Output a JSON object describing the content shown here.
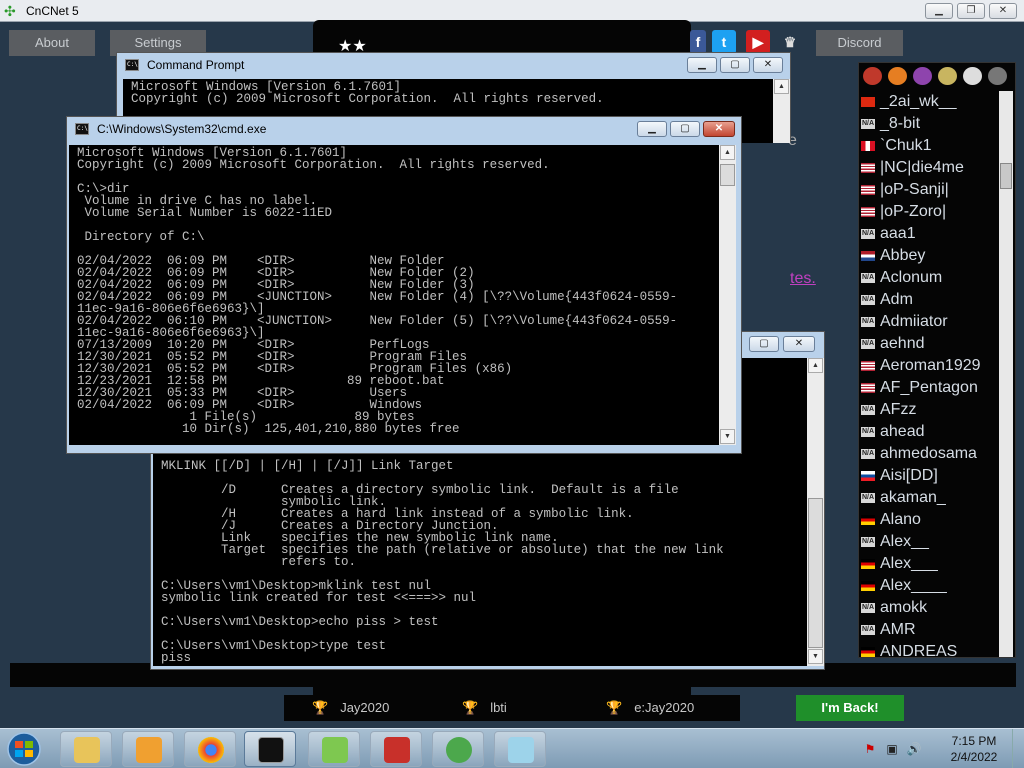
{
  "app": {
    "title": "CnCNet 5",
    "about_label": "About",
    "settings_label": "Settings",
    "discord_label": "Discord",
    "im_back_label": "I'm Back!",
    "link_fragment": "tes.",
    "e_fragment": "e"
  },
  "games": [
    {
      "name": "Jay2020"
    },
    {
      "name": "lbti"
    },
    {
      "name": "e:Jay2020"
    }
  ],
  "players": [
    {
      "name": "_2ai_wk__",
      "flag": "cn"
    },
    {
      "name": "_8-bit",
      "flag": "na"
    },
    {
      "name": "`Chuk1",
      "flag": "pe"
    },
    {
      "name": "|NC|die4me",
      "flag": "us"
    },
    {
      "name": "|oP-Sanji|",
      "flag": "us"
    },
    {
      "name": "|oP-Zoro|",
      "flag": "us"
    },
    {
      "name": "aaa1",
      "flag": "na"
    },
    {
      "name": "Abbey",
      "flag": "nl"
    },
    {
      "name": "Aclonum",
      "flag": "na"
    },
    {
      "name": "Adm",
      "flag": "na"
    },
    {
      "name": "Admiiator",
      "flag": "na"
    },
    {
      "name": "aehnd",
      "flag": "na"
    },
    {
      "name": "Aeroman1929",
      "flag": "us"
    },
    {
      "name": "AF_Pentagon",
      "flag": "us"
    },
    {
      "name": "AFzz",
      "flag": "na"
    },
    {
      "name": "ahead",
      "flag": "na"
    },
    {
      "name": "ahmedosama",
      "flag": "na"
    },
    {
      "name": "Aisi[DD]",
      "flag": "sk"
    },
    {
      "name": "akaman_",
      "flag": "na"
    },
    {
      "name": "Alano",
      "flag": "de"
    },
    {
      "name": "Alex__",
      "flag": "na"
    },
    {
      "name": "Alex___",
      "flag": "de"
    },
    {
      "name": "Alex____",
      "flag": "de"
    },
    {
      "name": "amokk",
      "flag": "na"
    },
    {
      "name": "AMR",
      "flag": "na"
    },
    {
      "name": "ANDREAS",
      "flag": "de"
    }
  ],
  "cmd_back": {
    "title": "Command Prompt",
    "text": "Microsoft Windows [Version 6.1.7601]\nCopyright (c) 2009 Microsoft Corporation.  All rights reserved."
  },
  "cmd_middle": {
    "text": "MKLINK [[/D] | [/H] | [/J]] Link Target\n\n        /D      Creates a directory symbolic link.  Default is a file\n                symbolic link.\n        /H      Creates a hard link instead of a symbolic link.\n        /J      Creates a Directory Junction.\n        Link    specifies the new symbolic link name.\n        Target  specifies the path (relative or absolute) that the new link\n                refers to.\n\nC:\\Users\\vm1\\Desktop>mklink test nul\nsymbolic link created for test <<===>> nul\n\nC:\\Users\\vm1\\Desktop>echo piss > test\n\nC:\\Users\\vm1\\Desktop>type test\npiss"
  },
  "cmd_front": {
    "title": "C:\\Windows\\System32\\cmd.exe",
    "text": "Microsoft Windows [Version 6.1.7601]\nCopyright (c) 2009 Microsoft Corporation.  All rights reserved.\n\nC:\\>dir\n Volume in drive C has no label.\n Volume Serial Number is 6022-11ED\n\n Directory of C:\\\n\n02/04/2022  06:09 PM    <DIR>          New Folder\n02/04/2022  06:09 PM    <DIR>          New Folder (2)\n02/04/2022  06:09 PM    <DIR>          New Folder (3)\n02/04/2022  06:09 PM    <JUNCTION>     New Folder (4) [\\??\\Volume{443f0624-0559-\n11ec-9a16-806e6f6e6963}\\]\n02/04/2022  06:10 PM    <JUNCTION>     New Folder (5) [\\??\\Volume{443f0624-0559-\n11ec-9a16-806e6f6e6963}\\]\n07/13/2009  10:20 PM    <DIR>          PerfLogs\n12/30/2021  05:52 PM    <DIR>          Program Files\n12/30/2021  05:52 PM    <DIR>          Program Files (x86)\n12/23/2021  12:58 PM                89 reboot.bat\n12/30/2021  05:33 PM    <DIR>          Users\n02/04/2022  06:09 PM    <DIR>          Windows\n               1 File(s)             89 bytes\n              10 Dir(s)  125,401,210,880 bytes free"
  },
  "clock": {
    "time": "7:15 PM",
    "date": "2/4/2022"
  }
}
